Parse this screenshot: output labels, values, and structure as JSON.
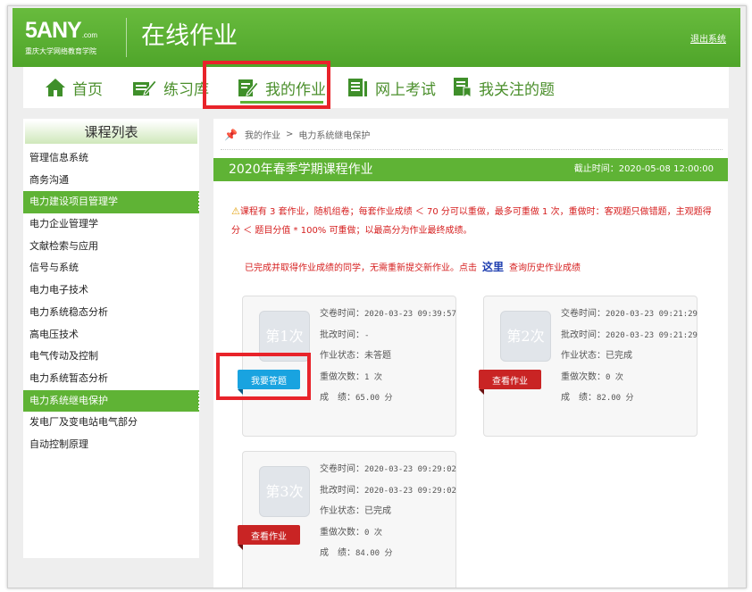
{
  "header": {
    "logo": "5ANY",
    "logo_suffix": ".com",
    "logo_sub": "重庆大学网络教育学院",
    "site_title": "在线作业",
    "logout": "退出系统"
  },
  "nav": [
    {
      "label": "首页",
      "icon": "home-icon"
    },
    {
      "label": "练习库",
      "icon": "practice-icon"
    },
    {
      "label": "我的作业",
      "icon": "homework-icon"
    },
    {
      "label": "网上考试",
      "icon": "exam-icon"
    },
    {
      "label": "我关注的题",
      "icon": "bookmark-icon"
    }
  ],
  "sidebar": {
    "title": "课程列表",
    "items": [
      {
        "label": "管理信息系统"
      },
      {
        "label": "商务沟通"
      },
      {
        "label": "电力建设项目管理学"
      },
      {
        "label": "电力企业管理学"
      },
      {
        "label": "文献检索与应用"
      },
      {
        "label": "信号与系统"
      },
      {
        "label": "电力电子技术"
      },
      {
        "label": "电力系统稳态分析"
      },
      {
        "label": "高电压技术"
      },
      {
        "label": "电气传动及控制"
      },
      {
        "label": "电力系统暂态分析"
      },
      {
        "label": "电力系统继电保护"
      },
      {
        "label": "发电厂及变电站电气部分"
      },
      {
        "label": "自动控制原理"
      }
    ]
  },
  "breadcrumb": {
    "home": "我的作业",
    "separator": ">",
    "current": "电力系统继电保护"
  },
  "banner": {
    "title": "2020年春季学期课程作业",
    "deadline_label": "截止时间：",
    "deadline": "2020-05-08 12:00:00"
  },
  "notice": {
    "text": "课程有 3 套作业，随机组卷；每套作业成绩 ＜ 70 分可以重做，最多可重做 1 次，重做时：客观题只做错题，主观题得分 ＜ 题目分值 * 100% 可重做；以最高分为作业最终成绩。",
    "completed_prefix": "已完成并取得作业成绩的同学，无需重新提交新作业。点击",
    "link": "这里",
    "completed_suffix": "查询历史作业成绩"
  },
  "labels": {
    "submit_time": "交卷时间：",
    "grade_time": "批改时间：",
    "status": "作业状态：",
    "redo": "重做次数：",
    "score": "成　绩："
  },
  "cards": [
    {
      "thumb": "第1次",
      "submit_time": "2020-03-23 09:39:57",
      "grade_time": "-",
      "status": "未答题",
      "redo": "1 次",
      "score": "65.00 分",
      "button": "我要答题"
    },
    {
      "thumb": "第2次",
      "submit_time": "2020-03-23 09:21:29",
      "grade_time": "2020-03-23 09:21:29",
      "status": "已完成",
      "redo": "0 次",
      "score": "82.00 分",
      "button": "查看作业"
    },
    {
      "thumb": "第3次",
      "submit_time": "2020-03-23 09:29:02",
      "grade_time": "2020-03-23 09:29:02",
      "status": "已完成",
      "redo": "0 次",
      "score": "84.00 分",
      "button": "查看作业"
    }
  ],
  "colors": {
    "brand_green": "#5fb335",
    "highlight_red": "#e8232a",
    "notice_red": "#d62020",
    "button_blue": "#19a3e0",
    "button_red": "#c92424"
  }
}
